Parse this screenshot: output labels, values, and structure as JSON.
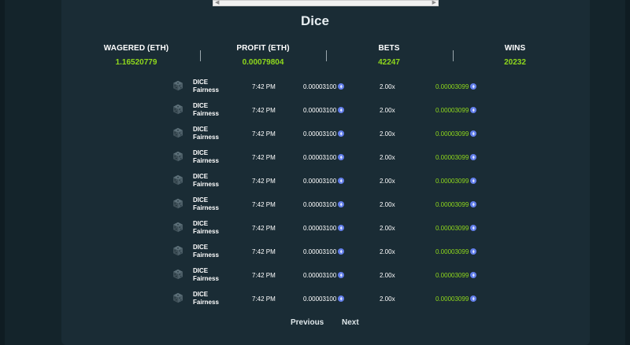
{
  "page": {
    "title": "Dice"
  },
  "stats": [
    {
      "label": "WAGERED (ETH)",
      "value": "1.16520779"
    },
    {
      "label": "PROFIT (ETH)",
      "value": "0.00079804"
    },
    {
      "label": "BETS",
      "value": "42247"
    },
    {
      "label": "WINS",
      "value": "20232"
    }
  ],
  "bets": [
    {
      "game": "DICE",
      "sub": "Fairness",
      "time": "7:42 PM",
      "amount": "0.00003100",
      "multiplier": "2.00x",
      "payout": "0.00003099"
    },
    {
      "game": "DICE",
      "sub": "Fairness",
      "time": "7:42 PM",
      "amount": "0.00003100",
      "multiplier": "2.00x",
      "payout": "0.00003099"
    },
    {
      "game": "DICE",
      "sub": "Fairness",
      "time": "7:42 PM",
      "amount": "0.00003100",
      "multiplier": "2.00x",
      "payout": "0.00003099"
    },
    {
      "game": "DICE",
      "sub": "Fairness",
      "time": "7:42 PM",
      "amount": "0.00003100",
      "multiplier": "2.00x",
      "payout": "0.00003099"
    },
    {
      "game": "DICE",
      "sub": "Fairness",
      "time": "7:42 PM",
      "amount": "0.00003100",
      "multiplier": "2.00x",
      "payout": "0.00003099"
    },
    {
      "game": "DICE",
      "sub": "Fairness",
      "time": "7:42 PM",
      "amount": "0.00003100",
      "multiplier": "2.00x",
      "payout": "0.00003099"
    },
    {
      "game": "DICE",
      "sub": "Fairness",
      "time": "7:42 PM",
      "amount": "0.00003100",
      "multiplier": "2.00x",
      "payout": "0.00003099"
    },
    {
      "game": "DICE",
      "sub": "Fairness",
      "time": "7:42 PM",
      "amount": "0.00003100",
      "multiplier": "2.00x",
      "payout": "0.00003099"
    },
    {
      "game": "DICE",
      "sub": "Fairness",
      "time": "7:42 PM",
      "amount": "0.00003100",
      "multiplier": "2.00x",
      "payout": "0.00003099"
    },
    {
      "game": "DICE",
      "sub": "Fairness",
      "time": "7:42 PM",
      "amount": "0.00003100",
      "multiplier": "2.00x",
      "payout": "0.00003099"
    }
  ],
  "icons": {
    "game": "dice-icon",
    "currency": "eth-icon"
  },
  "pagination": {
    "previous": "Previous",
    "next": "Next"
  },
  "colors": {
    "accent_green": "#8fd81c",
    "panel": "#1a2c35",
    "background": "#14242b",
    "eth": "#627eea"
  }
}
